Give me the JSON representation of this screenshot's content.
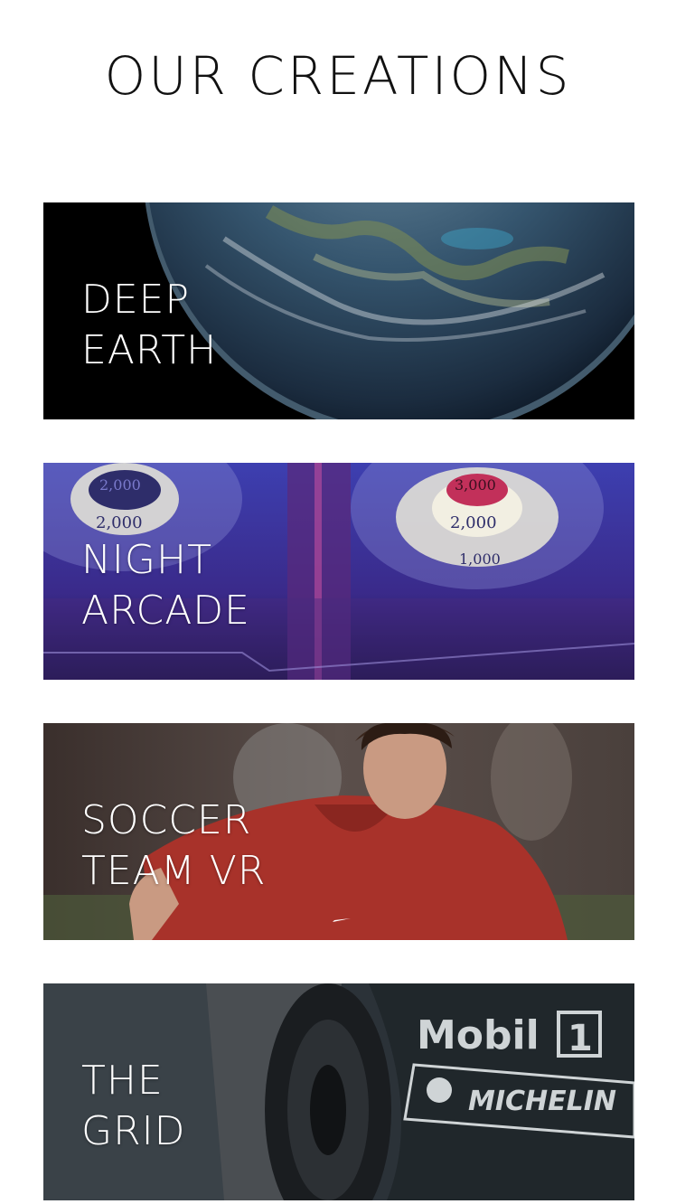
{
  "page": {
    "title": "OUR CREATIONS"
  },
  "cards": [
    {
      "line1": "DEEP",
      "line2": "EARTH",
      "image": "earth-from-space-image"
    },
    {
      "line1": "NIGHT",
      "line2": "ARCADE",
      "image": "skee-ball-arcade-image"
    },
    {
      "line1": "SOCCER",
      "line2": "TEAM VR",
      "image": "soccer-player-image"
    },
    {
      "line1": "THE",
      "line2": "GRID",
      "image": "race-car-image",
      "photo_text": {
        "brand1": "Mobil",
        "brand1_num": "1",
        "brand2": "MICHELIN"
      }
    }
  ],
  "photo_text": {
    "arcade_top_left": "2,000",
    "arcade_mid_left": "2,000",
    "arcade_top_right": "3,000",
    "arcade_mid_right": "2,000",
    "arcade_low_right": "1,000"
  }
}
